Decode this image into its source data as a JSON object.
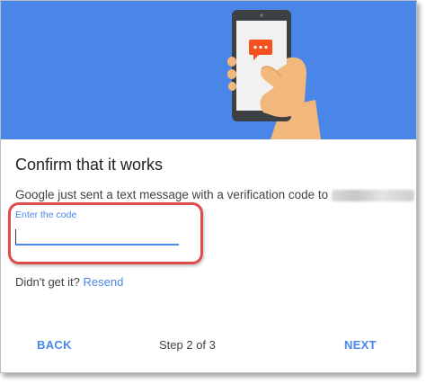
{
  "dialog": {
    "title": "Confirm that it works",
    "message": "Google just sent a text message with a verification code to",
    "phone_redacted": true
  },
  "code_input": {
    "label": "Enter the code",
    "value": ""
  },
  "resend": {
    "prompt": "Didn't get it?",
    "link": "Resend"
  },
  "footer": {
    "back_label": "BACK",
    "step_text": "Step 2 of 3",
    "next_label": "NEXT"
  },
  "colors": {
    "hero_background": "#4a86e8",
    "accent": "#4a86e8",
    "highlight": "#e04b4b",
    "chat_bubble": "#f4511e"
  },
  "icons": [
    "phone-in-hand-illustration",
    "chat-bubble-icon"
  ]
}
